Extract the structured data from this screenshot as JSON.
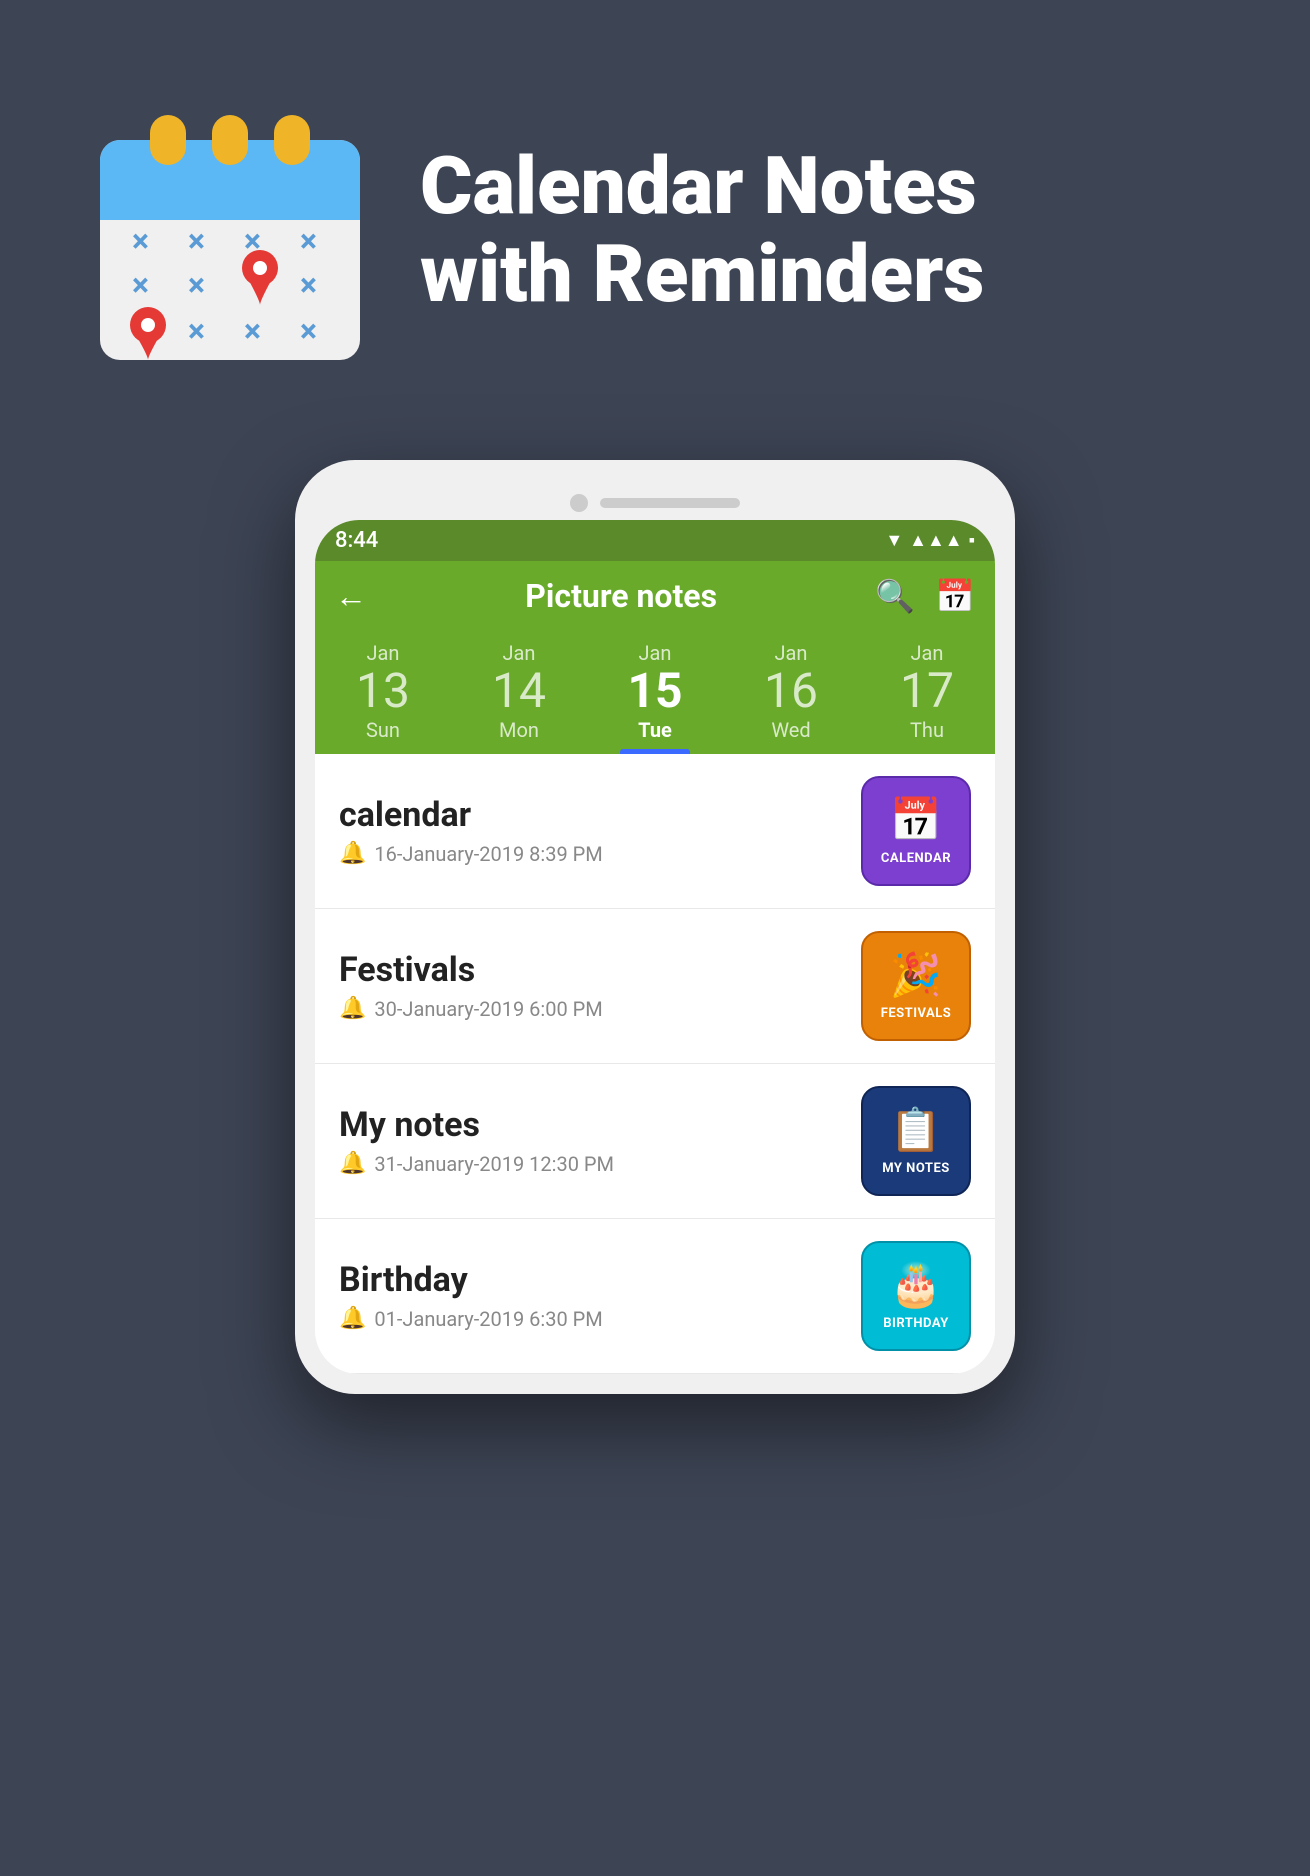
{
  "hero": {
    "title_line1": "Calendar Notes",
    "title_line2": "with Reminders"
  },
  "status_bar": {
    "time": "8:44"
  },
  "app_bar": {
    "title": "Picture notes"
  },
  "dates": [
    {
      "month": "Jan",
      "num": "13",
      "day": "Sun",
      "active": false
    },
    {
      "month": "Jan",
      "num": "14",
      "day": "Mon",
      "active": false
    },
    {
      "month": "Jan",
      "num": "15",
      "day": "Tue",
      "active": true
    },
    {
      "month": "Jan",
      "num": "16",
      "day": "Wed",
      "active": false
    },
    {
      "month": "Jan",
      "num": "17",
      "day": "Thu",
      "active": false
    }
  ],
  "notes": [
    {
      "title": "calendar",
      "reminder": "16-January-2019 8:39 PM",
      "badge_label": "Calendar",
      "badge_type": "calendar"
    },
    {
      "title": "Festivals",
      "reminder": "30-January-2019 6:00 PM",
      "badge_label": "FESTIVALS",
      "badge_type": "festivals"
    },
    {
      "title": "My notes",
      "reminder": "31-January-2019 12:30 PM",
      "badge_label": "MY NOTES",
      "badge_type": "mynotes"
    },
    {
      "title": "Birthday",
      "reminder": "01-January-2019 6:30 PM",
      "badge_label": "BIRTHDAY",
      "badge_type": "birthday"
    }
  ]
}
